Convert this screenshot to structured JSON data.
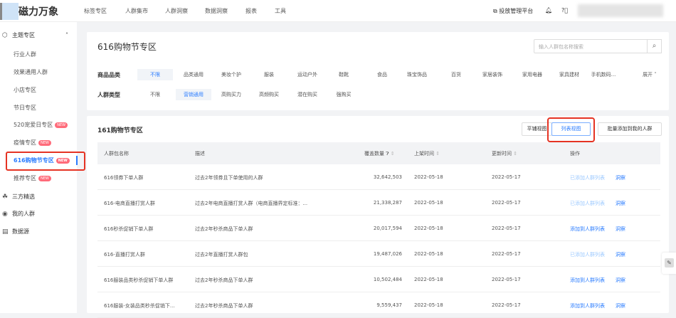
{
  "header": {
    "brand": "磁力万象",
    "nav": [
      "标签专区",
      "人群集市",
      "人群洞察",
      "数据洞察",
      "报表",
      "工具"
    ],
    "platform_link": "投放管理平台"
  },
  "sidebar": {
    "group": "主题专区",
    "sub_items": [
      {
        "label": "行业人群"
      },
      {
        "label": "效果通用人群"
      },
      {
        "label": "小店专区"
      },
      {
        "label": "节日专区"
      },
      {
        "label": "520宠爱日专区",
        "badge": "NEW"
      },
      {
        "label": "疫情专区",
        "badge": "NEW"
      },
      {
        "label": "616购物节专区",
        "badge": "NEW",
        "active": true
      },
      {
        "label": "推荐专区",
        "badge": "NEW"
      }
    ],
    "top_items": [
      "三方精选",
      "我的人群",
      "数据源"
    ]
  },
  "page": {
    "title": "616购物节专区",
    "search_placeholder": "输入人群包名称搜索"
  },
  "filters": {
    "category_label": "商品品类",
    "categories": [
      "不限",
      "品类通用",
      "美妆个护",
      "服装",
      "运动户外",
      "鞋靴",
      "食品",
      "珠宝饰品",
      "百货",
      "家居装饰",
      "家用电器",
      "家具建材",
      "手机数码..."
    ],
    "category_selected": 0,
    "expand": "展开",
    "type_label": "人群类型",
    "types": [
      "不限",
      "营销通用",
      "高购买力",
      "高频购买",
      "潜在购买",
      "强购买"
    ],
    "type_selected": 1
  },
  "list": {
    "title": "161购物节专区",
    "view_tile": "平铺视图",
    "view_list": "列表视图",
    "batch_add": "批量添加到我的人群",
    "columns": [
      "人群包名称",
      "描述",
      "覆盖数量",
      "上架时间",
      "更新时间",
      "操作"
    ],
    "rows": [
      {
        "name": "616领券下单人群",
        "desc": "过去2年领券且下单使用的人群",
        "count": "32,642,503",
        "listed": "2022-05-18",
        "updated": "2022-05-17",
        "action": "已添加人群列表",
        "added": true,
        "insight": "洞察"
      },
      {
        "name": "616-电商直播打赏人群",
        "desc": "过去2年电商直播打赏人群（电商直播界定标准：...",
        "count": "21,338,287",
        "listed": "2022-05-18",
        "updated": "2022-05-17",
        "action": "已添加人群列表",
        "added": true,
        "insight": "洞察"
      },
      {
        "name": "616秒杀促销下单人群",
        "desc": "过去2年秒杀商品下单人群",
        "count": "20,017,594",
        "listed": "2022-05-18",
        "updated": "2022-05-17",
        "action": "添加到人群列表",
        "added": false,
        "insight": "洞察"
      },
      {
        "name": "616-直播打赏人群",
        "desc": "过去2年直播打赏人群包",
        "count": "19,487,026",
        "listed": "2022-05-18",
        "updated": "2022-05-17",
        "action": "已添加人群列表",
        "added": true,
        "insight": "洞察"
      },
      {
        "name": "616服装品类秒杀促销下单人群",
        "desc": "过去2年秒杀商品下单人群",
        "count": "10,502,484",
        "listed": "2022-05-18",
        "updated": "2022-05-17",
        "action": "添加到人群列表",
        "added": false,
        "insight": "洞察"
      },
      {
        "name": "616服装-女装品类秒杀促销下...",
        "desc": "过去2年秒杀商品下单人群",
        "count": "9,559,437",
        "listed": "2022-05-18",
        "updated": "2022-05-17",
        "action": "添加到人群列表",
        "added": false,
        "insight": "洞察"
      }
    ]
  },
  "colors": {
    "accent": "#2a7cff",
    "highlight_box": "#e53323",
    "badge": "#ff6b7a"
  }
}
